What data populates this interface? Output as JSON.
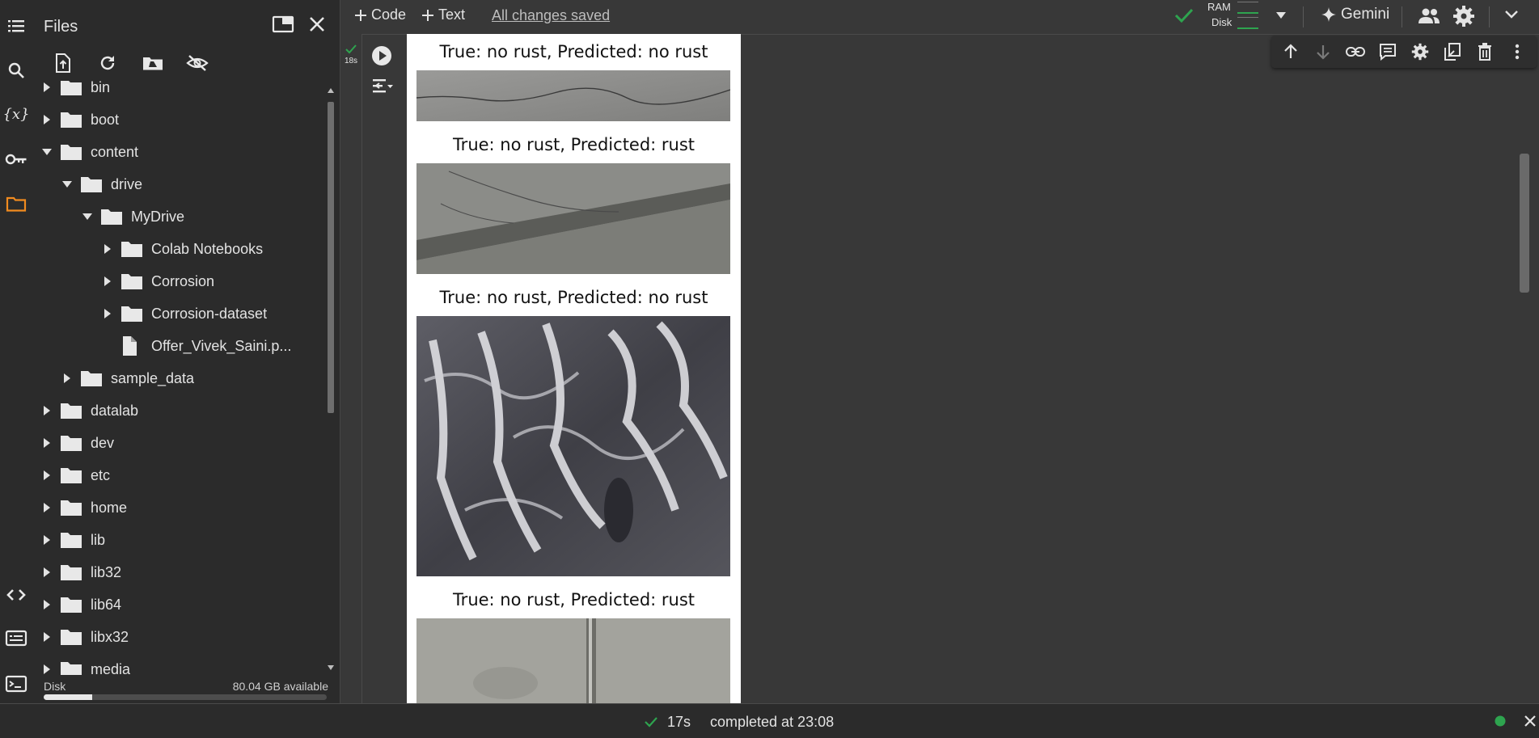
{
  "sidebar": {
    "title": "Files",
    "disk_label": "Disk",
    "disk_available": "80.04 GB available",
    "disk_used_fraction": 0.17,
    "rail_icons": [
      "table-of-contents-icon",
      "search-icon",
      "variables-icon",
      "key-icon",
      "folder-icon",
      "code-snippets-icon",
      "command-palette-icon",
      "terminal-icon"
    ],
    "toolbar_icons": [
      "upload-file-icon",
      "refresh-icon",
      "mount-drive-icon",
      "hide-files-icon"
    ],
    "tree": [
      {
        "label": "bin",
        "type": "folder",
        "depth": 0,
        "expanded": false
      },
      {
        "label": "boot",
        "type": "folder",
        "depth": 0,
        "expanded": false
      },
      {
        "label": "content",
        "type": "folder",
        "depth": 0,
        "expanded": true
      },
      {
        "label": "drive",
        "type": "folder",
        "depth": 1,
        "expanded": true
      },
      {
        "label": "MyDrive",
        "type": "folder",
        "depth": 2,
        "expanded": true
      },
      {
        "label": "Colab Notebooks",
        "type": "folder",
        "depth": 3,
        "expanded": false
      },
      {
        "label": "Corrosion",
        "type": "folder",
        "depth": 3,
        "expanded": false
      },
      {
        "label": "Corrosion-dataset",
        "type": "folder",
        "depth": 3,
        "expanded": false
      },
      {
        "label": "Offer_Vivek_Saini.p...",
        "type": "file",
        "depth": 3,
        "expanded": false
      },
      {
        "label": "sample_data",
        "type": "folder",
        "depth": 1,
        "expanded": false
      },
      {
        "label": "datalab",
        "type": "folder",
        "depth": 0,
        "expanded": false
      },
      {
        "label": "dev",
        "type": "folder",
        "depth": 0,
        "expanded": false
      },
      {
        "label": "etc",
        "type": "folder",
        "depth": 0,
        "expanded": false
      },
      {
        "label": "home",
        "type": "folder",
        "depth": 0,
        "expanded": false
      },
      {
        "label": "lib",
        "type": "folder",
        "depth": 0,
        "expanded": false
      },
      {
        "label": "lib32",
        "type": "folder",
        "depth": 0,
        "expanded": false
      },
      {
        "label": "lib64",
        "type": "folder",
        "depth": 0,
        "expanded": false
      },
      {
        "label": "libx32",
        "type": "folder",
        "depth": 0,
        "expanded": false
      },
      {
        "label": "media",
        "type": "folder",
        "depth": 0,
        "expanded": false
      }
    ]
  },
  "topbar": {
    "code_label": "Code",
    "text_label": "Text",
    "saved_label": "All changes saved",
    "ram_label": "RAM",
    "disk_label": "Disk",
    "gemini_label": "Gemini"
  },
  "cell": {
    "runtime": "18s",
    "toolbar_icons": [
      "move-up-icon",
      "move-down-icon",
      "link-icon",
      "comment-icon",
      "settings-icon",
      "mirror-cell-icon",
      "delete-icon",
      "more-options-icon"
    ],
    "outputs": [
      {
        "title": "True: no rust, Predicted: no rust"
      },
      {
        "title": "True: no rust, Predicted: rust"
      },
      {
        "title": "True: no rust, Predicted: no rust"
      },
      {
        "title": "True: no rust, Predicted: rust"
      }
    ]
  },
  "status": {
    "elapsed": "17s",
    "message": "completed at 23:08"
  },
  "colors": {
    "accent_orange": "#f18b1f",
    "success_green": "#2ea44f",
    "panel_bg": "#2b2b2b",
    "main_bg": "#383838"
  }
}
